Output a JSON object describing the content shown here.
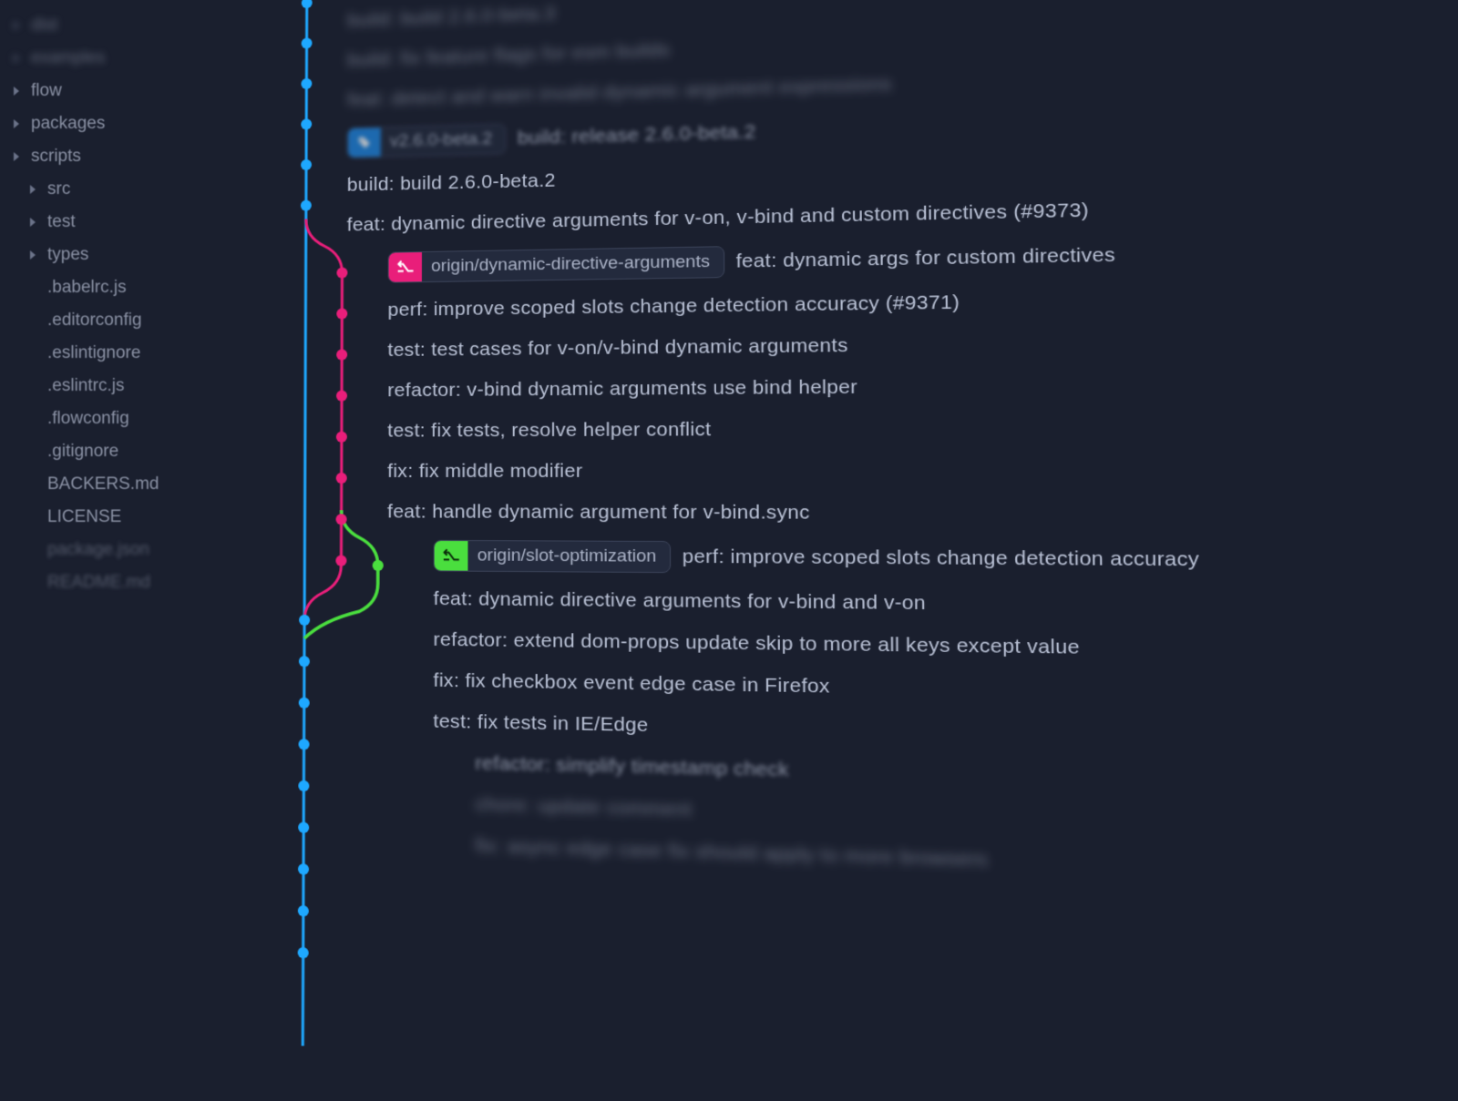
{
  "sidebar": {
    "items": [
      {
        "label": "dist",
        "expandable": true,
        "blurred": true,
        "indent": 0
      },
      {
        "label": "examples",
        "expandable": true,
        "blurred": true,
        "indent": 0
      },
      {
        "label": "flow",
        "expandable": true,
        "blurred": false,
        "indent": 0
      },
      {
        "label": "packages",
        "expandable": true,
        "blurred": false,
        "indent": 0
      },
      {
        "label": "scripts",
        "expandable": true,
        "blurred": false,
        "indent": 0
      },
      {
        "label": "src",
        "expandable": true,
        "blurred": false,
        "indent": 1
      },
      {
        "label": "test",
        "expandable": true,
        "blurred": false,
        "indent": 1
      },
      {
        "label": "types",
        "expandable": true,
        "blurred": false,
        "indent": 1
      },
      {
        "label": ".babelrc.js",
        "expandable": false,
        "blurred": false,
        "indent": 1
      },
      {
        "label": ".editorconfig",
        "expandable": false,
        "blurred": false,
        "indent": 1
      },
      {
        "label": ".eslintignore",
        "expandable": false,
        "blurred": false,
        "indent": 1
      },
      {
        "label": ".eslintrc.js",
        "expandable": false,
        "blurred": false,
        "indent": 1
      },
      {
        "label": ".flowconfig",
        "expandable": false,
        "blurred": false,
        "indent": 1
      },
      {
        "label": ".gitignore",
        "expandable": false,
        "blurred": false,
        "indent": 1
      },
      {
        "label": "BACKERS.md",
        "expandable": false,
        "blurred": false,
        "indent": 1
      },
      {
        "label": "LICENSE",
        "expandable": false,
        "blurred": false,
        "indent": 1
      },
      {
        "label": "package.json",
        "expandable": false,
        "blurred": false,
        "indent": 1,
        "dim": true
      },
      {
        "label": "README.md",
        "expandable": false,
        "blurred": true,
        "indent": 1,
        "dim": true
      }
    ]
  },
  "colors": {
    "bg": "#1a1f2e",
    "track_blue": "#1ea8ff",
    "track_pink": "#e91e7a",
    "track_green": "#4ade3e"
  },
  "commits": [
    {
      "message": "build: build 2.6.0-beta.3",
      "indent": 0,
      "blur": "heavy"
    },
    {
      "message": "build: fix feature flags for esm builds",
      "indent": 0,
      "blur": "heavy"
    },
    {
      "message": "feat: detect and warn invalid dynamic argument expressions",
      "indent": 0,
      "blur": "heavy"
    },
    {
      "tag": {
        "color": "blue",
        "label": "v2.6.0-beta.2",
        "icon": "tag"
      },
      "message": "build: release 2.6.0-beta.2",
      "indent": 0,
      "blur": "light"
    },
    {
      "message": "build: build 2.6.0-beta.2",
      "indent": 0
    },
    {
      "message": "feat: dynamic directive arguments for v-on, v-bind and custom directives (#9373)",
      "indent": 0
    },
    {
      "tag": {
        "color": "pink",
        "label": "origin/dynamic-directive-arguments",
        "icon": "branch"
      },
      "message": "feat: dynamic args for custom directives",
      "indent": 1
    },
    {
      "message": "perf: improve scoped slots change detection accuracy (#9371)",
      "indent": 1
    },
    {
      "message": "test: test cases for v-on/v-bind dynamic arguments",
      "indent": 1
    },
    {
      "message": "refactor: v-bind dynamic arguments use bind helper",
      "indent": 1
    },
    {
      "message": "test: fix tests, resolve helper conflict",
      "indent": 1
    },
    {
      "message": "fix: fix middle modifier",
      "indent": 1
    },
    {
      "message": "feat: handle dynamic argument for v-bind.sync",
      "indent": 1
    },
    {
      "tag": {
        "color": "green",
        "label": "origin/slot-optimization",
        "icon": "branch"
      },
      "message": "perf: improve scoped slots change detection accuracy",
      "indent": 2
    },
    {
      "message": "feat: dynamic directive arguments for v-bind and v-on",
      "indent": 2
    },
    {
      "message": "refactor: extend dom-props update skip to more all keys except value",
      "indent": 2
    },
    {
      "message": "fix: fix checkbox event edge case in Firefox",
      "indent": 2
    },
    {
      "message": "test: fix tests in IE/Edge",
      "indent": 2
    },
    {
      "message": "refactor: simplify timestamp check",
      "indent": 3,
      "blur": "light"
    },
    {
      "message": "chore: update comment",
      "indent": 3,
      "blur": "heavy"
    },
    {
      "message": "fix: async edge case fix should apply to more browsers",
      "indent": 3,
      "blur": "heavy"
    }
  ]
}
